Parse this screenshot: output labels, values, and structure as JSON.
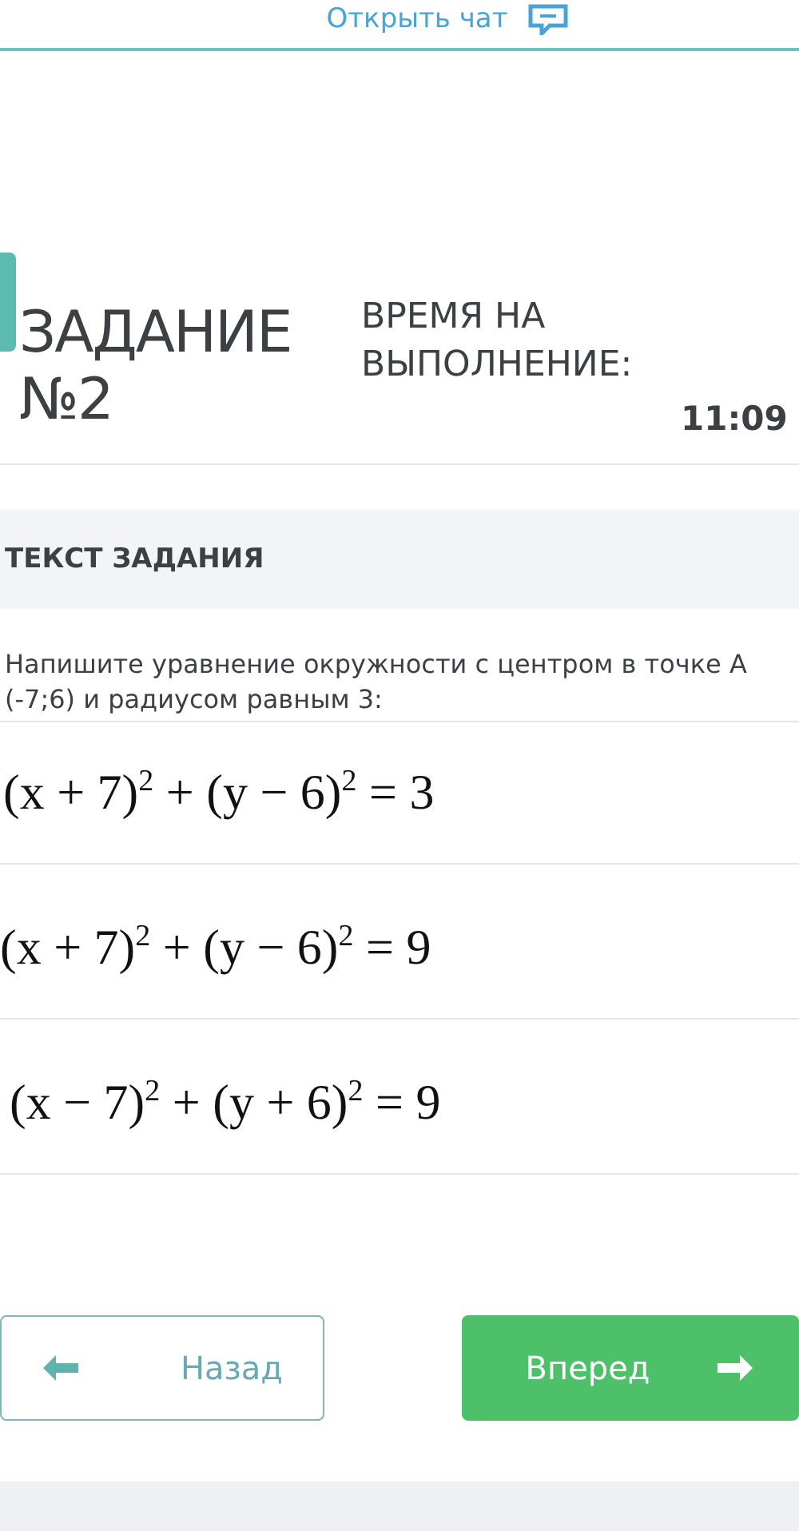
{
  "chat_link": {
    "label": "Открыть чат"
  },
  "task": {
    "title": "ЗАДАНИЕ №2",
    "time_label": "ВРЕМЯ НА ВЫПОЛНЕНИЕ:",
    "time_value": "11:09"
  },
  "section": {
    "heading": "ТЕКСТ ЗАДАНИЯ"
  },
  "question": "Напишите уравнение окружности с центром в точке А (-7;6) и радиусом равным 3:",
  "options": [
    {
      "formula": "(x + 7)$^{2}$ + (y − 6)$^{2}$ = 3"
    },
    {
      "formula": "(x + 7)$^{2}$ + (y − 6)$^{2}$ = 9"
    },
    {
      "formula": "(x − 7)$^{2}$ + (y + 6)$^{2}$ = 9"
    }
  ],
  "buttons": [
    {
      "kind": "back",
      "label": "Назад"
    },
    {
      "kind": "next",
      "label": "Вперед"
    }
  ]
}
